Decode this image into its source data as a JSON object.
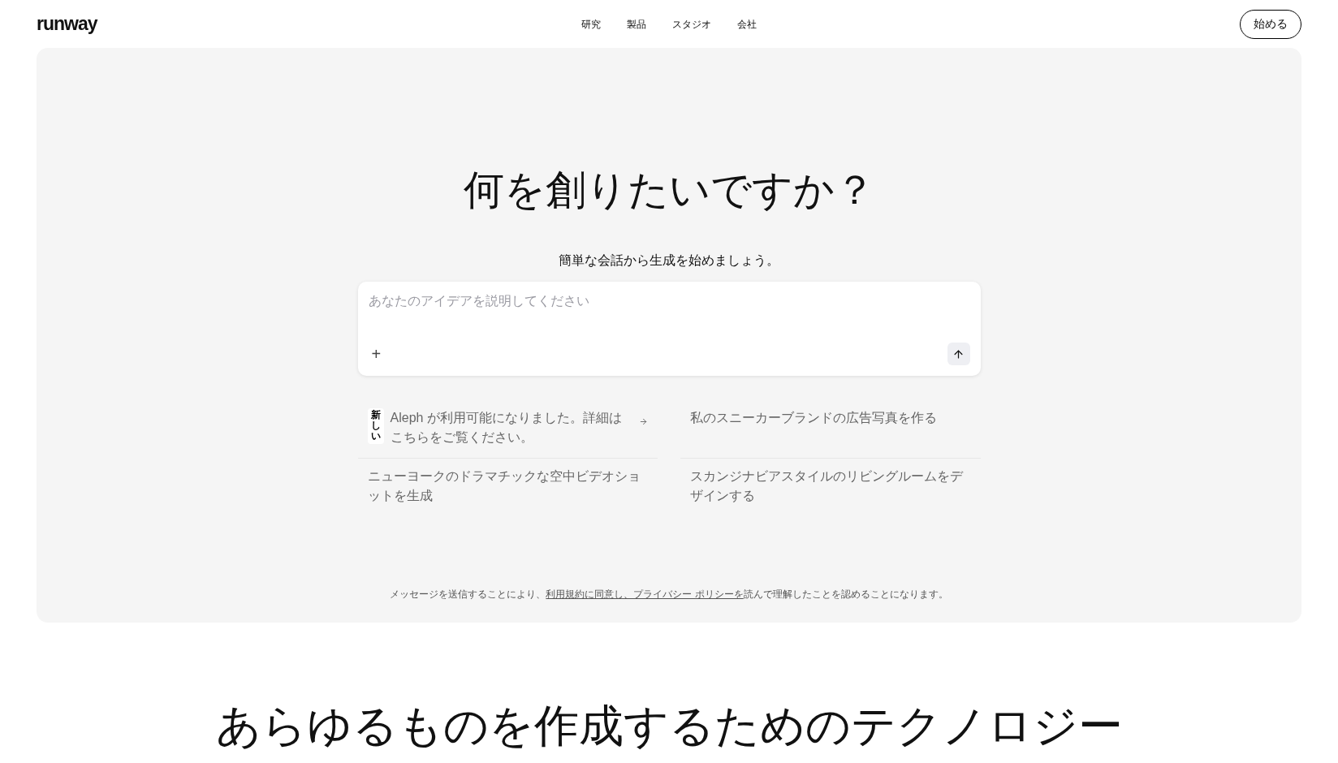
{
  "header": {
    "logo": "runway",
    "nav": [
      "研究",
      "製品",
      "スタジオ",
      "会社"
    ],
    "cta": "始める"
  },
  "hero": {
    "title": "何を創りたいですか？",
    "subtitle": "簡単な会話から生成を始めましょう。",
    "prompt": {
      "placeholder": "あなたのアイデアを説明してください",
      "add": "+"
    },
    "suggestions": [
      {
        "kind": "news",
        "badge": "新しい",
        "text": "Aleph が利用可能になりました。詳細はこちらをご覧ください。"
      },
      {
        "kind": "prompt",
        "text": "私のスニーカーブランドの広告写真を作る"
      },
      {
        "kind": "prompt",
        "text": "ニューヨークのドラマチックな空中ビデオショットを生成"
      },
      {
        "kind": "prompt",
        "text": "スカンジナビアスタイルのリビングルームをデザインする"
      }
    ],
    "legal": {
      "before": "メッセージを送信することにより、",
      "link": "利用規約に同意し、プライバシー ポリシーを",
      "after": "読んで理解したことを認めることになります。"
    }
  },
  "section": {
    "heading": "あらゆるものを作成するためのテクノロジー"
  }
}
